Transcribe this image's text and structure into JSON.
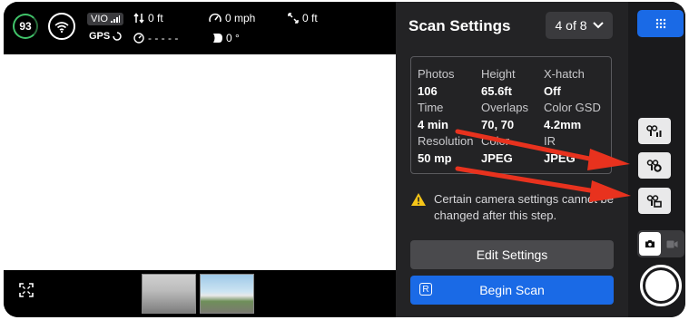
{
  "status": {
    "battery": "93",
    "vio_label": "VIO",
    "gps_label": "GPS",
    "altitude": "0 ft",
    "speed": "0 mph",
    "distance": "0 ft",
    "timer": "- - - - -",
    "heading": "0 °"
  },
  "scan": {
    "title": "Scan Settings",
    "pager": "4 of 8",
    "grid": [
      {
        "label": "Photos",
        "value": "106"
      },
      {
        "label": "Height",
        "value": "65.6ft"
      },
      {
        "label": "X-hatch",
        "value": "Off"
      },
      {
        "label": "Time",
        "value": "4 min"
      },
      {
        "label": "Overlaps",
        "value": "70, 70"
      },
      {
        "label": "Color GSD",
        "value": "4.2mm"
      },
      {
        "label": "Resolution",
        "value": "50 mp"
      },
      {
        "label": "Color",
        "value": "JPEG"
      },
      {
        "label": "IR",
        "value": "JPEG"
      }
    ],
    "warning": "Certain camera settings cannot be changed after this step.",
    "edit_label": "Edit Settings",
    "begin_label": "Begin Scan",
    "begin_key": "R"
  },
  "colors": {
    "accent": "#1a6ae6",
    "battery": "#41c46a",
    "warning": "#f5c518",
    "arrow": "#e8321e"
  },
  "icons": [
    "wifi-icon",
    "signal-icon",
    "gps-spinner-icon",
    "altitude-arrows-icon",
    "speedometer-icon",
    "distance-arrows-icon",
    "clock-icon",
    "heading-icon",
    "fullscreen-icon",
    "chevron-down-icon",
    "warning-icon",
    "grid-menu-icon",
    "camera-icon",
    "video-icon"
  ]
}
